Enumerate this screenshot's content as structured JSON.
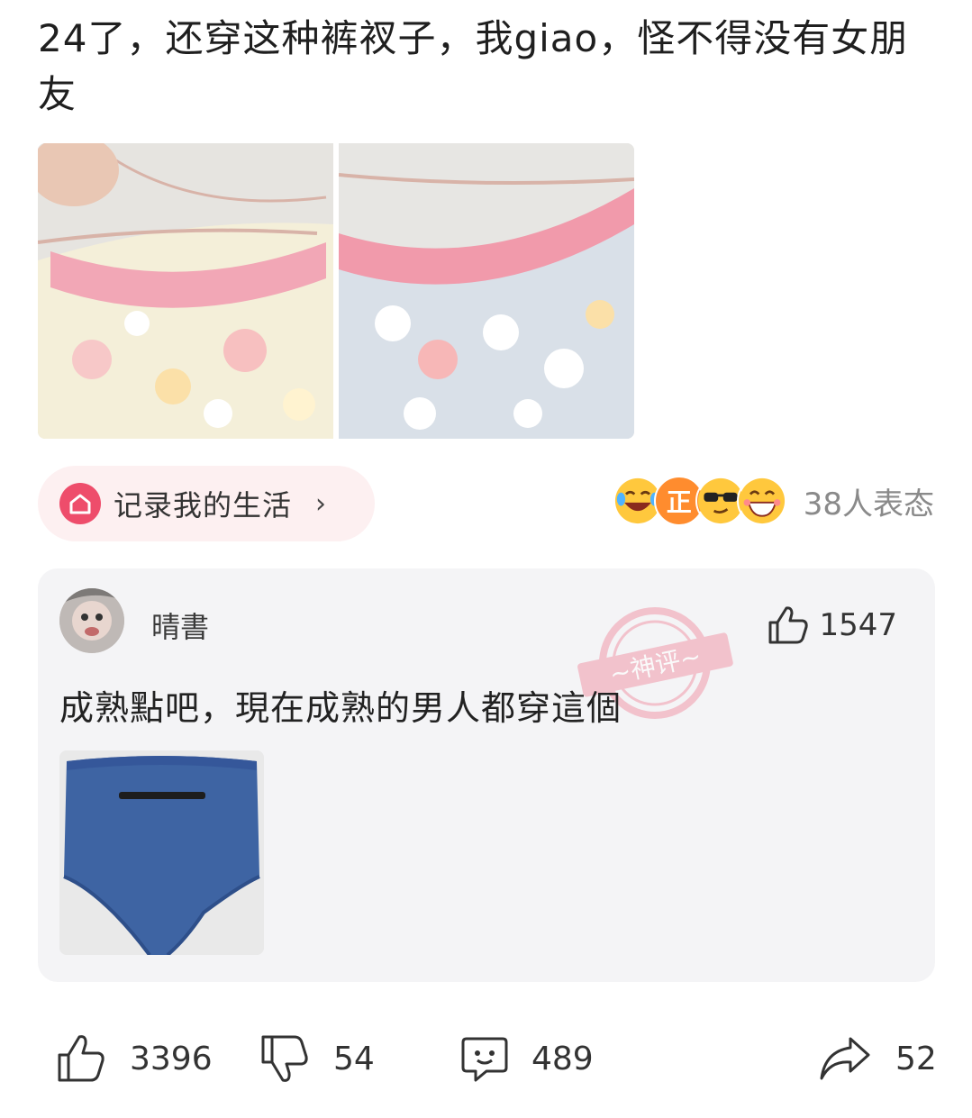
{
  "post": {
    "title": "24了，还穿这种裤衩子，我giao，怪不得没有女朋友"
  },
  "topic": {
    "label": "记录我的生活",
    "arrow": "›"
  },
  "reactions": {
    "count_text": "38人表态",
    "emojis": [
      "laugh-cry-emoji",
      "zheng-emoji",
      "sunglasses-emoji",
      "grin-emoji"
    ],
    "emoji_badge_text": "正"
  },
  "god_comment": {
    "username": "晴書",
    "likes": "1547",
    "stamp_text": "~神评~",
    "text": "成熟點吧，現在成熟的男人都穿這個"
  },
  "actions": {
    "like": "3396",
    "dislike": "54",
    "comment": "489",
    "share": "52"
  },
  "colors": {
    "accent": "#ee4d6b",
    "chip_bg": "#fdf0f1",
    "card_bg": "#f4f4f6"
  }
}
